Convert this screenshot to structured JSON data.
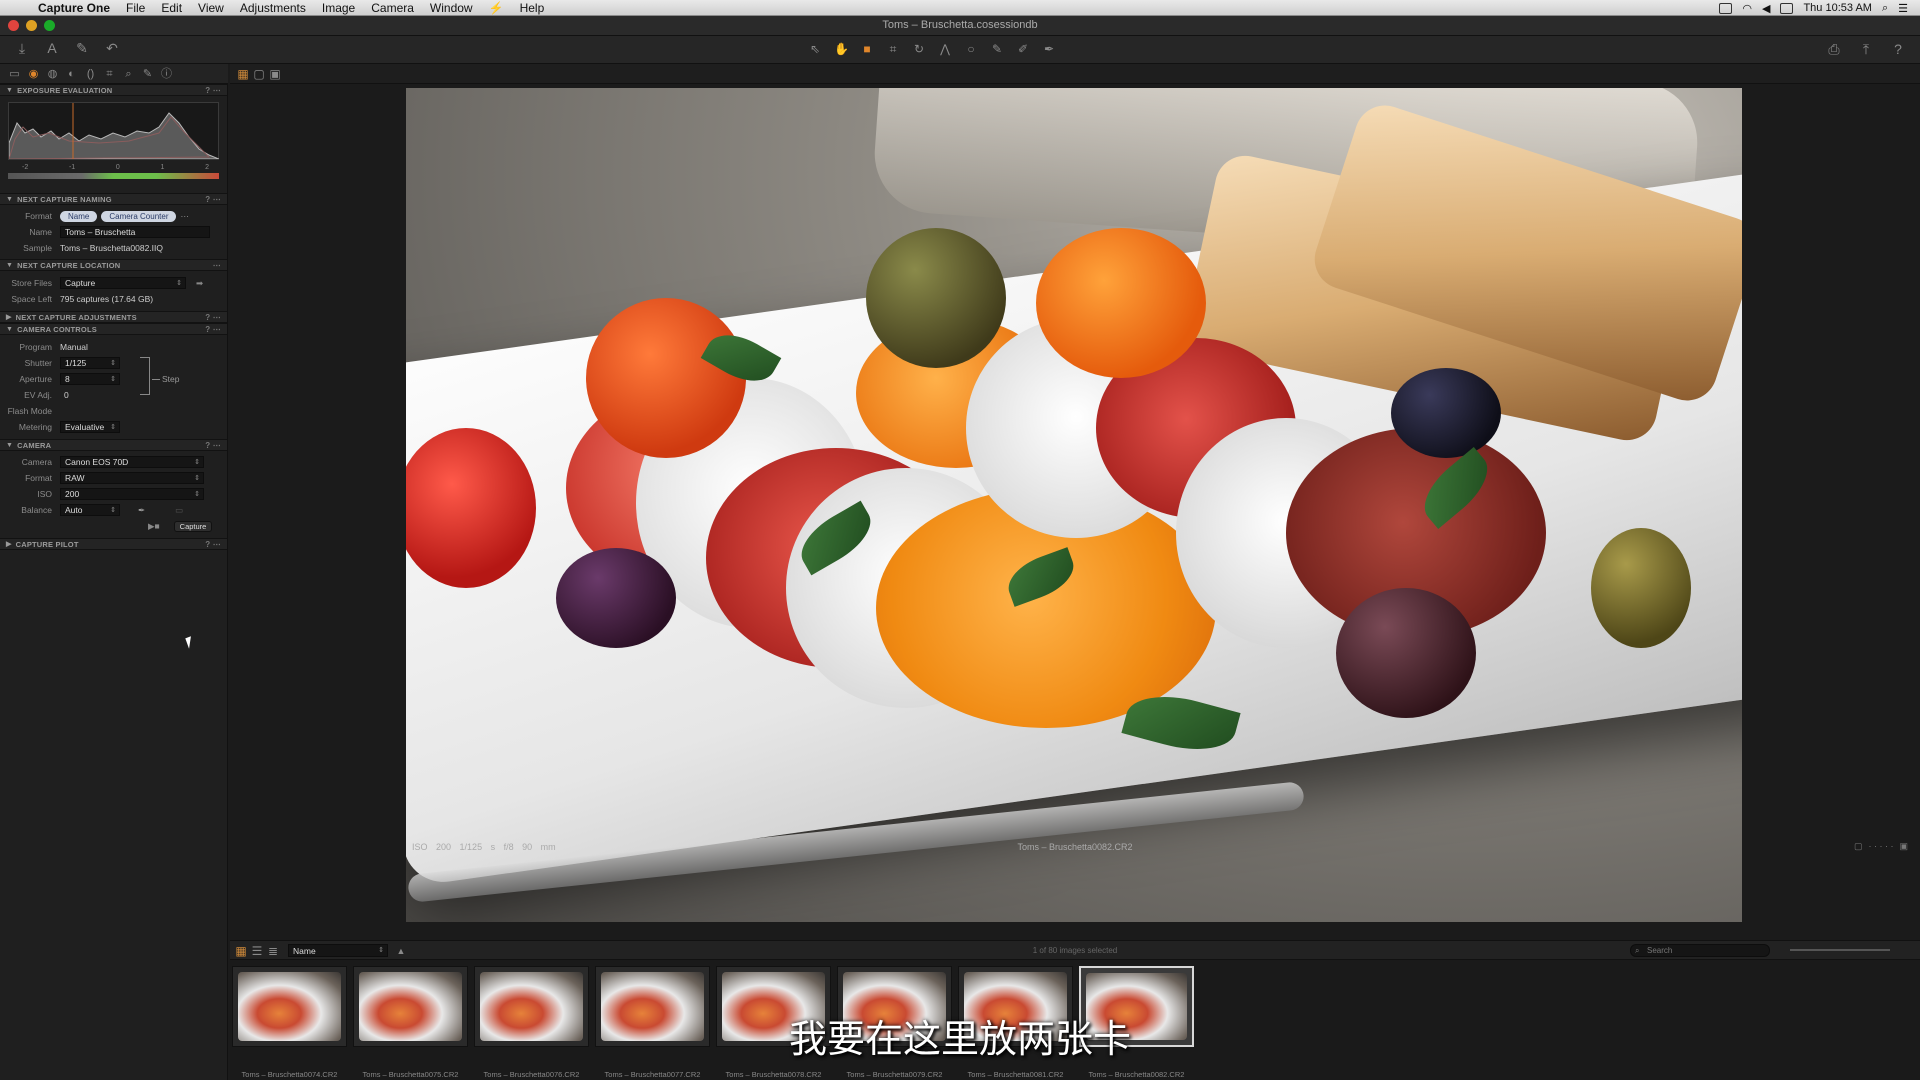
{
  "menubar": {
    "app_name": "Capture One",
    "items": [
      "File",
      "Edit",
      "View",
      "Adjustments",
      "Image",
      "Camera",
      "Window",
      "Help"
    ],
    "clock": "Thu 10:53 AM"
  },
  "window": {
    "title": "Toms – Bruschetta.cosessiondb"
  },
  "exposure": {
    "title": "EXPOSURE EVALUATION",
    "ticks": [
      "-2",
      "-1",
      "0",
      "1",
      "2"
    ]
  },
  "naming": {
    "title": "NEXT CAPTURE NAMING",
    "format_label": "Format",
    "tokens": [
      "Name",
      "Camera Counter"
    ],
    "name_label": "Name",
    "name_value": "Toms – Bruschetta",
    "sample_label": "Sample",
    "sample_value": "Toms – Bruschetta0082.IIQ"
  },
  "location": {
    "title": "NEXT CAPTURE LOCATION",
    "store_label": "Store Files",
    "store_value": "Capture",
    "space_label": "Space Left",
    "space_value": "795 captures (17.64 GB)"
  },
  "adjustments": {
    "title": "NEXT CAPTURE ADJUSTMENTS"
  },
  "camera_controls": {
    "title": "CAMERA CONTROLS",
    "program_label": "Program",
    "program_value": "Manual",
    "shutter_label": "Shutter",
    "shutter_value": "1/125",
    "aperture_label": "Aperture",
    "aperture_value": "8",
    "ev_label": "EV Adj.",
    "ev_value": "0",
    "step_label": "Step",
    "flash_label": "Flash Mode",
    "metering_label": "Metering",
    "metering_value": "Evaluative"
  },
  "camera": {
    "title": "CAMERA",
    "camera_label": "Camera",
    "camera_value": "Canon EOS 70D",
    "format_label": "Format",
    "format_value": "RAW",
    "iso_label": "ISO",
    "iso_value": "200",
    "balance_label": "Balance",
    "balance_value": "Auto",
    "capture_button": "Capture"
  },
  "pilot": {
    "title": "CAPTURE PILOT"
  },
  "viewer": {
    "meta": [
      "ISO 200",
      "1/125 s",
      "f/8",
      "90 mm"
    ],
    "filename": "Toms – Bruschetta0082.CR2"
  },
  "browser": {
    "sort_value": "Name",
    "count_text": "1 of 80 images selected",
    "search_placeholder": "Search"
  },
  "filmstrip": {
    "names": [
      "Toms – Bruschetta0074.CR2",
      "Toms – Bruschetta0075.CR2",
      "Toms – Bruschetta0076.CR2",
      "Toms – Bruschetta0077.CR2",
      "Toms – Bruschetta0078.CR2",
      "Toms – Bruschetta0079.CR2",
      "Toms – Bruschetta0081.CR2",
      "Toms – Bruschetta0082.CR2"
    ],
    "selected_index": 7
  },
  "subtitle": "我要在这里放两张卡"
}
